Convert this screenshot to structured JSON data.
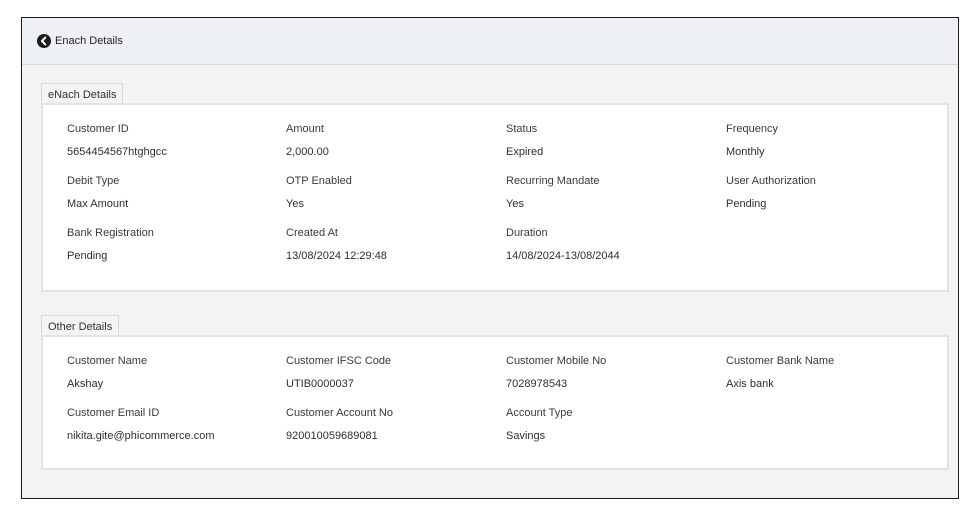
{
  "header": {
    "title": "Enach Details",
    "back_icon": "back-arrow-circle-icon"
  },
  "enach_section": {
    "title": "eNach Details",
    "fields": [
      {
        "label": "Customer ID",
        "value": "5654454567htghgcc"
      },
      {
        "label": "Amount",
        "value": "2,000.00"
      },
      {
        "label": "Status",
        "value": "Expired"
      },
      {
        "label": "Frequency",
        "value": "Monthly"
      },
      {
        "label": "Debit Type",
        "value": "Max Amount"
      },
      {
        "label": "OTP Enabled",
        "value": "Yes"
      },
      {
        "label": "Recurring Mandate",
        "value": "Yes"
      },
      {
        "label": "User Authorization",
        "value": "Pending"
      },
      {
        "label": "Bank Registration",
        "value": "Pending"
      },
      {
        "label": "Created At",
        "value": "13/08/2024 12:29:48"
      },
      {
        "label": "Duration",
        "value": "14/08/2024-13/08/2044"
      }
    ]
  },
  "other_section": {
    "title": "Other Details",
    "fields": [
      {
        "label": "Customer Name",
        "value": "Akshay"
      },
      {
        "label": "Customer IFSC Code",
        "value": "UTIB0000037"
      },
      {
        "label": "Customer Mobile No",
        "value": "7028978543"
      },
      {
        "label": "Customer Bank Name",
        "value": "Axis bank"
      },
      {
        "label": "Customer Email ID",
        "value": "nikita.gite@phicommerce.com"
      },
      {
        "label": "Customer Account No",
        "value": "920010059689081"
      },
      {
        "label": "Account Type",
        "value": "Savings"
      }
    ]
  }
}
